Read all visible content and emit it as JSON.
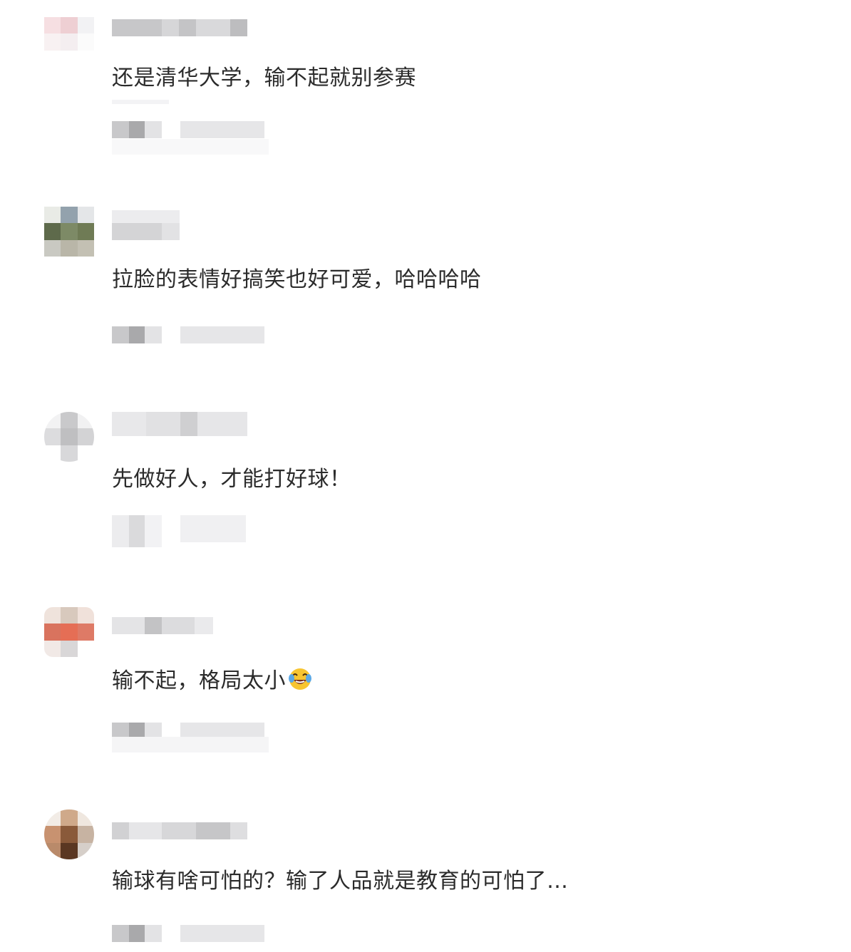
{
  "comments": [
    {
      "text": "还是清华大学，输不起就别参赛"
    },
    {
      "text": "拉脸的表情好搞笑也好可爱，哈哈哈哈"
    },
    {
      "text": "先做好人，才能打好球！"
    },
    {
      "text": "输不起，格局太小",
      "emoji": "laughing-crying-emoji"
    },
    {
      "text": "输球有啥可怕的？输了人品就是教育的可怕了…"
    }
  ]
}
